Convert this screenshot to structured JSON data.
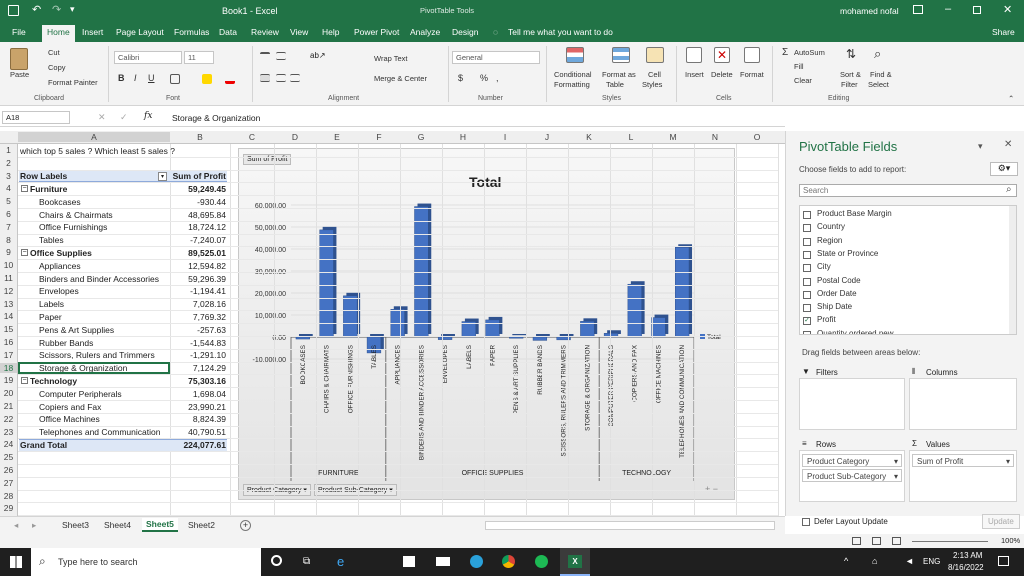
{
  "titlebar": {
    "autosave_icon": "save-icon",
    "doc_title": "Book1 - Excel",
    "context": "PivotTable Tools",
    "user": "mohamed nofal"
  },
  "tabs": [
    "File",
    "Home",
    "Insert",
    "Page Layout",
    "Formulas",
    "Data",
    "Review",
    "View",
    "Help",
    "Power Pivot",
    "Analyze",
    "Design"
  ],
  "tell_me": "Tell me what you want to do",
  "share": "Share",
  "ribbon": {
    "clipboard": {
      "paste": "Paste",
      "cut": "Cut",
      "copy": "Copy",
      "format_painter": "Format Painter",
      "group": "Clipboard"
    },
    "font": {
      "name": "Calibri",
      "size": "11",
      "group": "Font",
      "bold": "B",
      "italic": "I",
      "underline": "U"
    },
    "alignment": {
      "wrap": "Wrap Text",
      "merge": "Merge & Center",
      "group": "Alignment"
    },
    "number": {
      "format": "General",
      "group": "Number",
      "dollar": "$",
      "percent": "%",
      "comma": ","
    },
    "styles": {
      "conditional": "Conditional",
      "conditional2": "Formatting",
      "format_as": "Format as",
      "format_as2": "Table",
      "cell": "Cell",
      "cell2": "Styles",
      "group": "Styles"
    },
    "cells": {
      "insert": "Insert",
      "delete": "Delete",
      "format": "Format",
      "group": "Cells"
    },
    "editing": {
      "autosum": "AutoSum",
      "fill": "Fill",
      "clear": "Clear",
      "sort": "Sort &",
      "sort2": "Filter",
      "find": "Find &",
      "find2": "Select",
      "group": "Editing"
    }
  },
  "formula": {
    "namebox": "A18",
    "content": "Storage & Organization"
  },
  "columns": [
    "A",
    "B",
    "C",
    "D",
    "E",
    "F",
    "G",
    "H",
    "I",
    "J",
    "K",
    "L",
    "M",
    "N",
    "O"
  ],
  "rows": [
    "1",
    "2",
    "3",
    "4",
    "5",
    "6",
    "7",
    "8",
    "9",
    "10",
    "11",
    "12",
    "13",
    "14",
    "15",
    "16",
    "17",
    "18",
    "19",
    "20",
    "21",
    "22",
    "23",
    "24",
    "25",
    "26",
    "27",
    "28",
    "29"
  ],
  "sheet": {
    "note": "which top 5 sales ? Which least 5 sales ?",
    "header_label": "Row Labels",
    "header_value": "Sum of Profit",
    "lines": [
      {
        "label": "Furniture",
        "value": "59,249.45",
        "level": 0
      },
      {
        "label": "Bookcases",
        "value": "-930.44",
        "level": 1
      },
      {
        "label": "Chairs & Chairmats",
        "value": "48,695.84",
        "level": 1
      },
      {
        "label": "Office Furnishings",
        "value": "18,724.12",
        "level": 1
      },
      {
        "label": "Tables",
        "value": "-7,240.07",
        "level": 1
      },
      {
        "label": "Office Supplies",
        "value": "89,525.01",
        "level": 0
      },
      {
        "label": "Appliances",
        "value": "12,594.82",
        "level": 1
      },
      {
        "label": "Binders and Binder Accessories",
        "value": "59,296.39",
        "level": 1
      },
      {
        "label": "Envelopes",
        "value": "-1,194.41",
        "level": 1
      },
      {
        "label": "Labels",
        "value": "7,028.16",
        "level": 1
      },
      {
        "label": "Paper",
        "value": "7,769.32",
        "level": 1
      },
      {
        "label": "Pens & Art Supplies",
        "value": "-257.63",
        "level": 1
      },
      {
        "label": "Rubber Bands",
        "value": "-1,544.83",
        "level": 1
      },
      {
        "label": "Scissors, Rulers and Trimmers",
        "value": "-1,291.10",
        "level": 1
      },
      {
        "label": "Storage & Organization",
        "value": "7,124.29",
        "level": 1
      },
      {
        "label": "Technology",
        "value": "75,303.16",
        "level": 0
      },
      {
        "label": "Computer Peripherals",
        "value": "1,698.04",
        "level": 1
      },
      {
        "label": "Copiers and Fax",
        "value": "23,990.21",
        "level": 1
      },
      {
        "label": "Office Machines",
        "value": "8,824.39",
        "level": 1
      },
      {
        "label": "Telephones and Communication",
        "value": "40,790.51",
        "level": 1
      }
    ],
    "grand_label": "Grand Total",
    "grand_value": "224,077.61"
  },
  "chart_data": {
    "type": "bar",
    "title": "Total",
    "field_button": "Sum of Profit",
    "legend": [
      "Total"
    ],
    "legend_position": "right",
    "ylim": [
      -10000,
      60000
    ],
    "yticks": [
      "60,000.00",
      "50,000.00",
      "40,000.00",
      "30,000.00",
      "20,000.00",
      "10,000.00",
      "0.00",
      "-10,000.00"
    ],
    "categories": [
      "BOOKCASES",
      "CHAIRS & CHAIRMATS",
      "OFFICE FURNISHINGS",
      "TABLES",
      "APPLIANCES",
      "BINDERS AND BINDER ACCESSORIES",
      "ENVELOPES",
      "LABELS",
      "PAPER",
      "PENS & ART SUPPLIES",
      "RUBBER BANDS",
      "SCISSORS, RULERS AND TRIMMERS",
      "STORAGE & ORGANIZATION",
      "COMPUTER PERIPHERALS",
      "COPIERS AND FAX",
      "OFFICE MACHINES",
      "TELEPHONES AND COMMUNICATION"
    ],
    "values": [
      -930.44,
      48695.84,
      18724.12,
      -7240.07,
      12594.82,
      59296.39,
      -1194.41,
      7028.16,
      7769.32,
      -257.63,
      -1544.83,
      -1291.1,
      7124.29,
      1698.04,
      23990.21,
      8824.39,
      40790.51
    ],
    "groups": [
      {
        "name": "FURNITURE",
        "count": 4
      },
      {
        "name": "OFFICE SUPPLIES",
        "count": 9
      },
      {
        "name": "TECHNOLOGY",
        "count": 4
      }
    ],
    "axis_buttons": [
      "Product Category",
      "Product Sub-Category"
    ],
    "color": "#4472c4"
  },
  "panel": {
    "title": "PivotTable Fields",
    "subtitle": "Choose fields to add to report:",
    "search_placeholder": "Search",
    "fields": [
      {
        "name": "Product Base Margin",
        "checked": false
      },
      {
        "name": "Country",
        "checked": false
      },
      {
        "name": "Region",
        "checked": false
      },
      {
        "name": "State or Province",
        "checked": false
      },
      {
        "name": "City",
        "checked": false
      },
      {
        "name": "Postal Code",
        "checked": false
      },
      {
        "name": "Order Date",
        "checked": false
      },
      {
        "name": "Ship Date",
        "checked": false
      },
      {
        "name": "Profit",
        "checked": true
      },
      {
        "name": "Quantity ordered new",
        "checked": false
      }
    ],
    "drag_hint": "Drag fields between areas below:",
    "filters": "Filters",
    "columns": "Columns",
    "rows_label": "Rows",
    "values_label": "Values",
    "row_items": [
      "Product Category",
      "Product Sub-Category"
    ],
    "value_items": [
      "Sum of Profit"
    ],
    "defer": "Defer Layout Update",
    "update": "Update"
  },
  "sheets": [
    "Sheet3",
    "Sheet4",
    "Sheet5",
    "Sheet2"
  ],
  "active_sheet": "Sheet5",
  "status": {
    "zoom": "100%"
  },
  "taskbar": {
    "search": "Type here to search",
    "time": "2:13 AM",
    "date": "8/16/2022",
    "lang": "ENG"
  },
  "colors": {
    "excel_green": "#217346",
    "bar": "#4472c4"
  }
}
